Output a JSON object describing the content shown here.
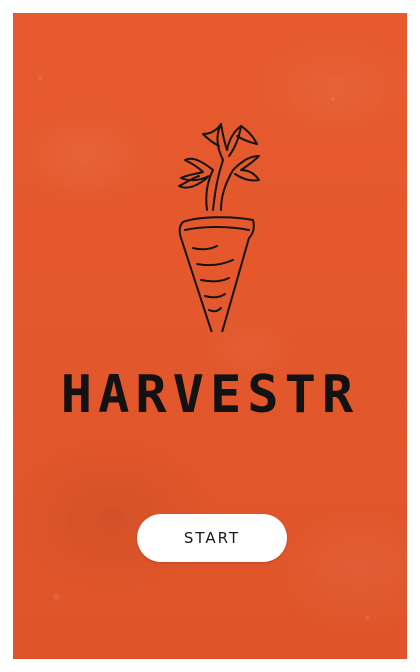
{
  "app": {
    "title": "HARVESTR",
    "logo_icon": "carrot-icon"
  },
  "actions": {
    "start_label": "START"
  },
  "colors": {
    "background": "#e6572a",
    "title_text": "#121212",
    "button_bg": "#ffffff",
    "button_text": "#1a1a1a"
  }
}
